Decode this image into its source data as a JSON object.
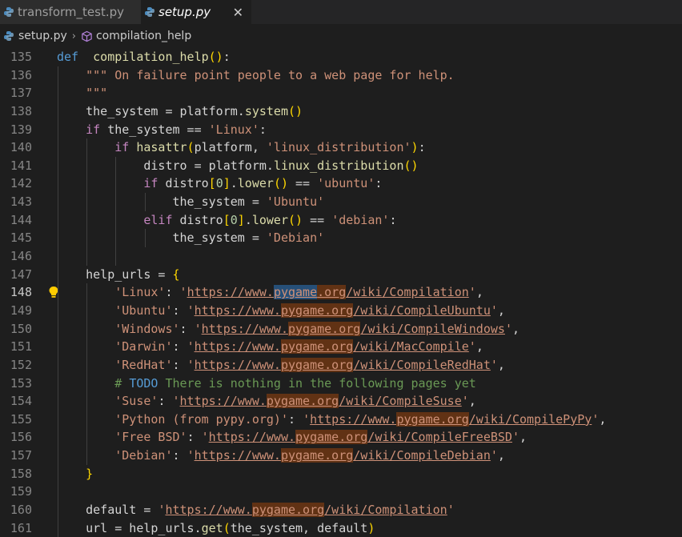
{
  "tabs": [
    {
      "label": "transform_test.py",
      "active": false
    },
    {
      "label": "setup.py",
      "active": true
    }
  ],
  "breadcrumb": {
    "file": "setup.py",
    "symbol": "compilation_help"
  },
  "lines": [
    {
      "num": "135",
      "tokens": [
        [
          "kw",
          "def"
        ],
        [
          "",
          "  "
        ],
        [
          "fn",
          "compilation_help"
        ],
        [
          "b1",
          "()"
        ],
        [
          "var",
          ":"
        ]
      ]
    },
    {
      "num": "136",
      "tokens": [
        [
          "str",
          "\"\"\" On failure point people to a web page for help."
        ]
      ]
    },
    {
      "num": "137",
      "tokens": [
        [
          "str",
          "\"\"\""
        ]
      ]
    },
    {
      "num": "138",
      "tokens": [
        [
          "var",
          "the_system = platform."
        ],
        [
          "fn",
          "system"
        ],
        [
          "b1",
          "()"
        ]
      ]
    },
    {
      "num": "139",
      "tokens": [
        [
          "ctl",
          "if"
        ],
        [
          "var",
          " the_system == "
        ],
        [
          "str",
          "'Linux'"
        ],
        [
          "var",
          ":"
        ]
      ]
    },
    {
      "num": "140",
      "tokens": [
        [
          "ctl",
          "if"
        ],
        [
          "var",
          " "
        ],
        [
          "fn",
          "hasattr"
        ],
        [
          "b1",
          "("
        ],
        [
          "var",
          "platform, "
        ],
        [
          "str",
          "'linux_distribution'"
        ],
        [
          "b1",
          ")"
        ],
        [
          "var",
          ":"
        ]
      ]
    },
    {
      "num": "141",
      "tokens": [
        [
          "var",
          "distro = platform."
        ],
        [
          "fn",
          "linux_distribution"
        ],
        [
          "b1",
          "()"
        ]
      ]
    },
    {
      "num": "142",
      "tokens": [
        [
          "ctl",
          "if"
        ],
        [
          "var",
          " distro"
        ],
        [
          "b1",
          "["
        ],
        [
          "num",
          "0"
        ],
        [
          "b1",
          "]"
        ],
        [
          "var",
          "."
        ],
        [
          "fn",
          "lower"
        ],
        [
          "b1",
          "()"
        ],
        [
          "var",
          " == "
        ],
        [
          "str",
          "'ubuntu'"
        ],
        [
          "var",
          ":"
        ]
      ]
    },
    {
      "num": "143",
      "tokens": [
        [
          "var",
          "the_system = "
        ],
        [
          "str",
          "'Ubuntu'"
        ]
      ]
    },
    {
      "num": "144",
      "tokens": [
        [
          "ctl",
          "elif"
        ],
        [
          "var",
          " distro"
        ],
        [
          "b1",
          "["
        ],
        [
          "num",
          "0"
        ],
        [
          "b1",
          "]"
        ],
        [
          "var",
          "."
        ],
        [
          "fn",
          "lower"
        ],
        [
          "b1",
          "()"
        ],
        [
          "var",
          " == "
        ],
        [
          "str",
          "'debian'"
        ],
        [
          "var",
          ":"
        ]
      ]
    },
    {
      "num": "145",
      "tokens": [
        [
          "var",
          "the_system = "
        ],
        [
          "str",
          "'Debian'"
        ]
      ]
    },
    {
      "num": "146",
      "tokens": []
    },
    {
      "num": "147",
      "tokens": [
        [
          "var",
          "help_urls = "
        ],
        [
          "b1",
          "{"
        ]
      ]
    },
    {
      "num": "148",
      "tokens": [
        [
          "str",
          "'Linux'"
        ],
        [
          "var",
          ": "
        ],
        [
          "str",
          "'"
        ],
        [
          "url",
          "https://www."
        ],
        [
          "urlsel",
          "pygame"
        ],
        [
          "urlhl",
          ".org"
        ],
        [
          "url",
          "/wiki/Compilation"
        ],
        [
          "str",
          "'"
        ],
        [
          "var",
          ","
        ]
      ]
    },
    {
      "num": "149",
      "tokens": [
        [
          "str",
          "'Ubuntu'"
        ],
        [
          "var",
          ": "
        ],
        [
          "str",
          "'"
        ],
        [
          "url",
          "https://www."
        ],
        [
          "urlhl",
          "pygame.org"
        ],
        [
          "url",
          "/wiki/CompileUbuntu"
        ],
        [
          "str",
          "'"
        ],
        [
          "var",
          ","
        ]
      ]
    },
    {
      "num": "150",
      "tokens": [
        [
          "str",
          "'Windows'"
        ],
        [
          "var",
          ": "
        ],
        [
          "str",
          "'"
        ],
        [
          "url",
          "https://www."
        ],
        [
          "urlhl",
          "pygame.org"
        ],
        [
          "url",
          "/wiki/CompileWindows"
        ],
        [
          "str",
          "'"
        ],
        [
          "var",
          ","
        ]
      ]
    },
    {
      "num": "151",
      "tokens": [
        [
          "str",
          "'Darwin'"
        ],
        [
          "var",
          ": "
        ],
        [
          "str",
          "'"
        ],
        [
          "url",
          "https://www."
        ],
        [
          "urlhl",
          "pygame.org"
        ],
        [
          "url",
          "/wiki/MacCompile"
        ],
        [
          "str",
          "'"
        ],
        [
          "var",
          ","
        ]
      ]
    },
    {
      "num": "152",
      "tokens": [
        [
          "str",
          "'RedHat'"
        ],
        [
          "var",
          ": "
        ],
        [
          "str",
          "'"
        ],
        [
          "url",
          "https://www."
        ],
        [
          "urlhl",
          "pygame.org"
        ],
        [
          "url",
          "/wiki/CompileRedHat"
        ],
        [
          "str",
          "'"
        ],
        [
          "var",
          ","
        ]
      ]
    },
    {
      "num": "153",
      "tokens": [
        [
          "cmt",
          "# "
        ],
        [
          "todo",
          "TODO"
        ],
        [
          "cmt",
          " There is nothing in the following pages yet"
        ]
      ]
    },
    {
      "num": "154",
      "tokens": [
        [
          "str",
          "'Suse'"
        ],
        [
          "var",
          ": "
        ],
        [
          "str",
          "'"
        ],
        [
          "url",
          "https://www."
        ],
        [
          "urlhl",
          "pygame.org"
        ],
        [
          "url",
          "/wiki/CompileSuse"
        ],
        [
          "str",
          "'"
        ],
        [
          "var",
          ","
        ]
      ]
    },
    {
      "num": "155",
      "tokens": [
        [
          "str",
          "'Python (from pypy.org)'"
        ],
        [
          "var",
          ": "
        ],
        [
          "str",
          "'"
        ],
        [
          "url",
          "https://www."
        ],
        [
          "urlhl",
          "pygame.org"
        ],
        [
          "url",
          "/wiki/CompilePyPy"
        ],
        [
          "str",
          "'"
        ],
        [
          "var",
          ","
        ]
      ]
    },
    {
      "num": "156",
      "tokens": [
        [
          "str",
          "'Free BSD'"
        ],
        [
          "var",
          ": "
        ],
        [
          "str",
          "'"
        ],
        [
          "url",
          "https://www."
        ],
        [
          "urlhl",
          "pygame.org"
        ],
        [
          "url",
          "/wiki/CompileFreeBSD"
        ],
        [
          "str",
          "'"
        ],
        [
          "var",
          ","
        ]
      ]
    },
    {
      "num": "157",
      "tokens": [
        [
          "str",
          "'Debian'"
        ],
        [
          "var",
          ": "
        ],
        [
          "str",
          "'"
        ],
        [
          "url",
          "https://www."
        ],
        [
          "urlhl",
          "pygame.org"
        ],
        [
          "url",
          "/wiki/CompileDebian"
        ],
        [
          "str",
          "'"
        ],
        [
          "var",
          ","
        ]
      ]
    },
    {
      "num": "158",
      "tokens": [
        [
          "b1",
          "}"
        ]
      ]
    },
    {
      "num": "159",
      "tokens": []
    },
    {
      "num": "160",
      "tokens": [
        [
          "var",
          "default = "
        ],
        [
          "str",
          "'"
        ],
        [
          "url",
          "https://www."
        ],
        [
          "urlhl",
          "pygame.org"
        ],
        [
          "url",
          "/wiki/Compilation"
        ],
        [
          "str",
          "'"
        ]
      ]
    },
    {
      "num": "161",
      "tokens": [
        [
          "var",
          "url = help_urls."
        ],
        [
          "fn",
          "get"
        ],
        [
          "b1",
          "("
        ],
        [
          "var",
          "the_system, default"
        ],
        [
          "b1",
          ")"
        ]
      ]
    }
  ],
  "current_line": "148"
}
